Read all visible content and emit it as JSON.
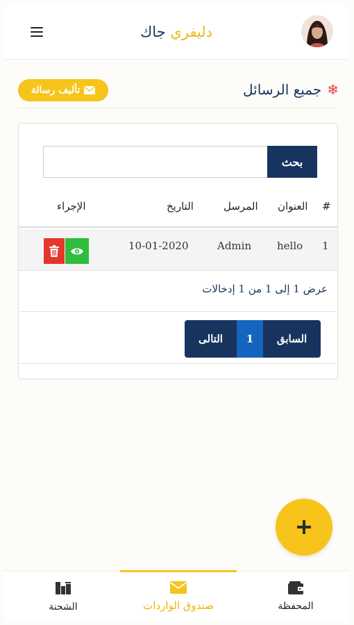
{
  "header": {
    "brand_part1": "جاك",
    "brand_part2": "دليفري",
    "menu_icon": "hamburger-icon",
    "avatar_icon": "user-avatar"
  },
  "page": {
    "title": "جميع الرسائل",
    "title_icon": "snowflake-icon",
    "compose_label": "تأليف رسالة",
    "compose_icon": "envelope-icon"
  },
  "search": {
    "button_label": "بحث",
    "value": "",
    "placeholder": ""
  },
  "table": {
    "columns": {
      "num": "#",
      "subject": "العنوان",
      "sender": "المرسل",
      "date": "التاريخ",
      "action": "الإجراء"
    },
    "rows": [
      {
        "num": "1",
        "subject": "hello",
        "sender": "Admin",
        "date": "10-01-2020"
      }
    ],
    "info": "عرض 1 إلى 1 من 1 إدخالات"
  },
  "pagination": {
    "prev_label": "السابق",
    "current_page": "1",
    "next_label": "التالى"
  },
  "fab": {
    "icon": "plus-icon"
  },
  "bottom_nav": {
    "items": [
      {
        "label": "الشحنة",
        "icon": "shipment-icon"
      },
      {
        "label": "صندوق الواردات",
        "icon": "envelope-icon",
        "active": true
      },
      {
        "label": "المحفظة",
        "icon": "wallet-icon"
      }
    ]
  },
  "colors": {
    "accent": "#f6c41a",
    "primary": "#17345f",
    "view": "#2ebd3c",
    "delete": "#e5362d",
    "page_active": "#1565c0"
  }
}
